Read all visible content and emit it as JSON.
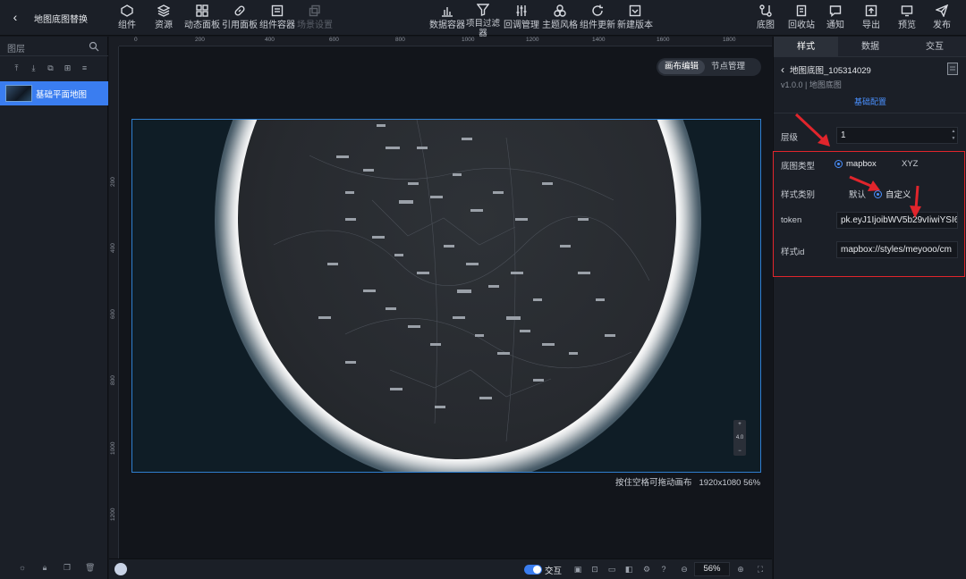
{
  "header": {
    "title": "地图底图替换",
    "left_tools": [
      {
        "label": "组件",
        "icon": "component-icon"
      },
      {
        "label": "资源",
        "icon": "layers-icon"
      },
      {
        "label": "动态面板",
        "icon": "grid-icon"
      },
      {
        "label": "引用面板",
        "icon": "link-icon"
      },
      {
        "label": "组件容器",
        "icon": "container-icon"
      },
      {
        "label": "场景设置",
        "icon": "copy-icon"
      }
    ],
    "center_tools": [
      {
        "label": "数据容器",
        "icon": "chart-icon"
      },
      {
        "label": "项目过滤器",
        "icon": "filter-icon"
      },
      {
        "label": "回调管理",
        "icon": "sliders-icon"
      },
      {
        "label": "主题风格",
        "icon": "theme-icon"
      },
      {
        "label": "组件更新",
        "icon": "refresh-icon"
      },
      {
        "label": "新建版本",
        "icon": "new-version-icon"
      }
    ],
    "right_tools": [
      {
        "label": "底图",
        "icon": "basemap-icon"
      },
      {
        "label": "回收站",
        "icon": "trash-icon"
      },
      {
        "label": "通知",
        "icon": "message-icon"
      },
      {
        "label": "导出",
        "icon": "export-icon"
      },
      {
        "label": "预览",
        "icon": "preview-icon"
      },
      {
        "label": "发布",
        "icon": "send-icon"
      }
    ]
  },
  "left_panel": {
    "search_label": "图层",
    "layers": [
      {
        "name": "基础平面地图"
      }
    ]
  },
  "canvas": {
    "ruler_h": [
      "0",
      "200",
      "400",
      "600",
      "800",
      "1000",
      "1200",
      "1400",
      "1600",
      "1800"
    ],
    "ruler_v": [
      "200",
      "400",
      "600",
      "800",
      "1000",
      "1200"
    ],
    "mode_tabs": [
      "画布编辑",
      "节点管理"
    ],
    "active_mode": "画布编辑",
    "zoom_level_map": "4.0",
    "hint_text": "按住空格可拖动画布",
    "canvas_size": "1920x1080",
    "canvas_scale": "56%"
  },
  "right_panel": {
    "tabs": [
      "样式",
      "数据",
      "交互"
    ],
    "active_tab": "样式",
    "component_name": "地图底图_105314029",
    "version": "v1.0.0 | 地图底图",
    "section": "基础配置",
    "level_label": "层级",
    "level_value": "1",
    "basemap_type_label": "底图类型",
    "basemap_types": [
      "mapbox",
      "XYZ"
    ],
    "basemap_type_selected": "mapbox",
    "style_category_label": "样式类别",
    "style_categories": [
      "默认",
      "自定义"
    ],
    "style_category_selected": "自定义",
    "token_label": "token",
    "token_value": "pk.eyJ1IjoibWV5b29vIiwiYSI6",
    "style_id_label": "样式id",
    "style_id_value": "mapbox://styles/meyooo/cm"
  },
  "bottom_bar": {
    "interact_label": "交互",
    "zoom": "56%"
  },
  "colors": {
    "accent": "#3a7df0",
    "annotation": "#e1252c"
  }
}
